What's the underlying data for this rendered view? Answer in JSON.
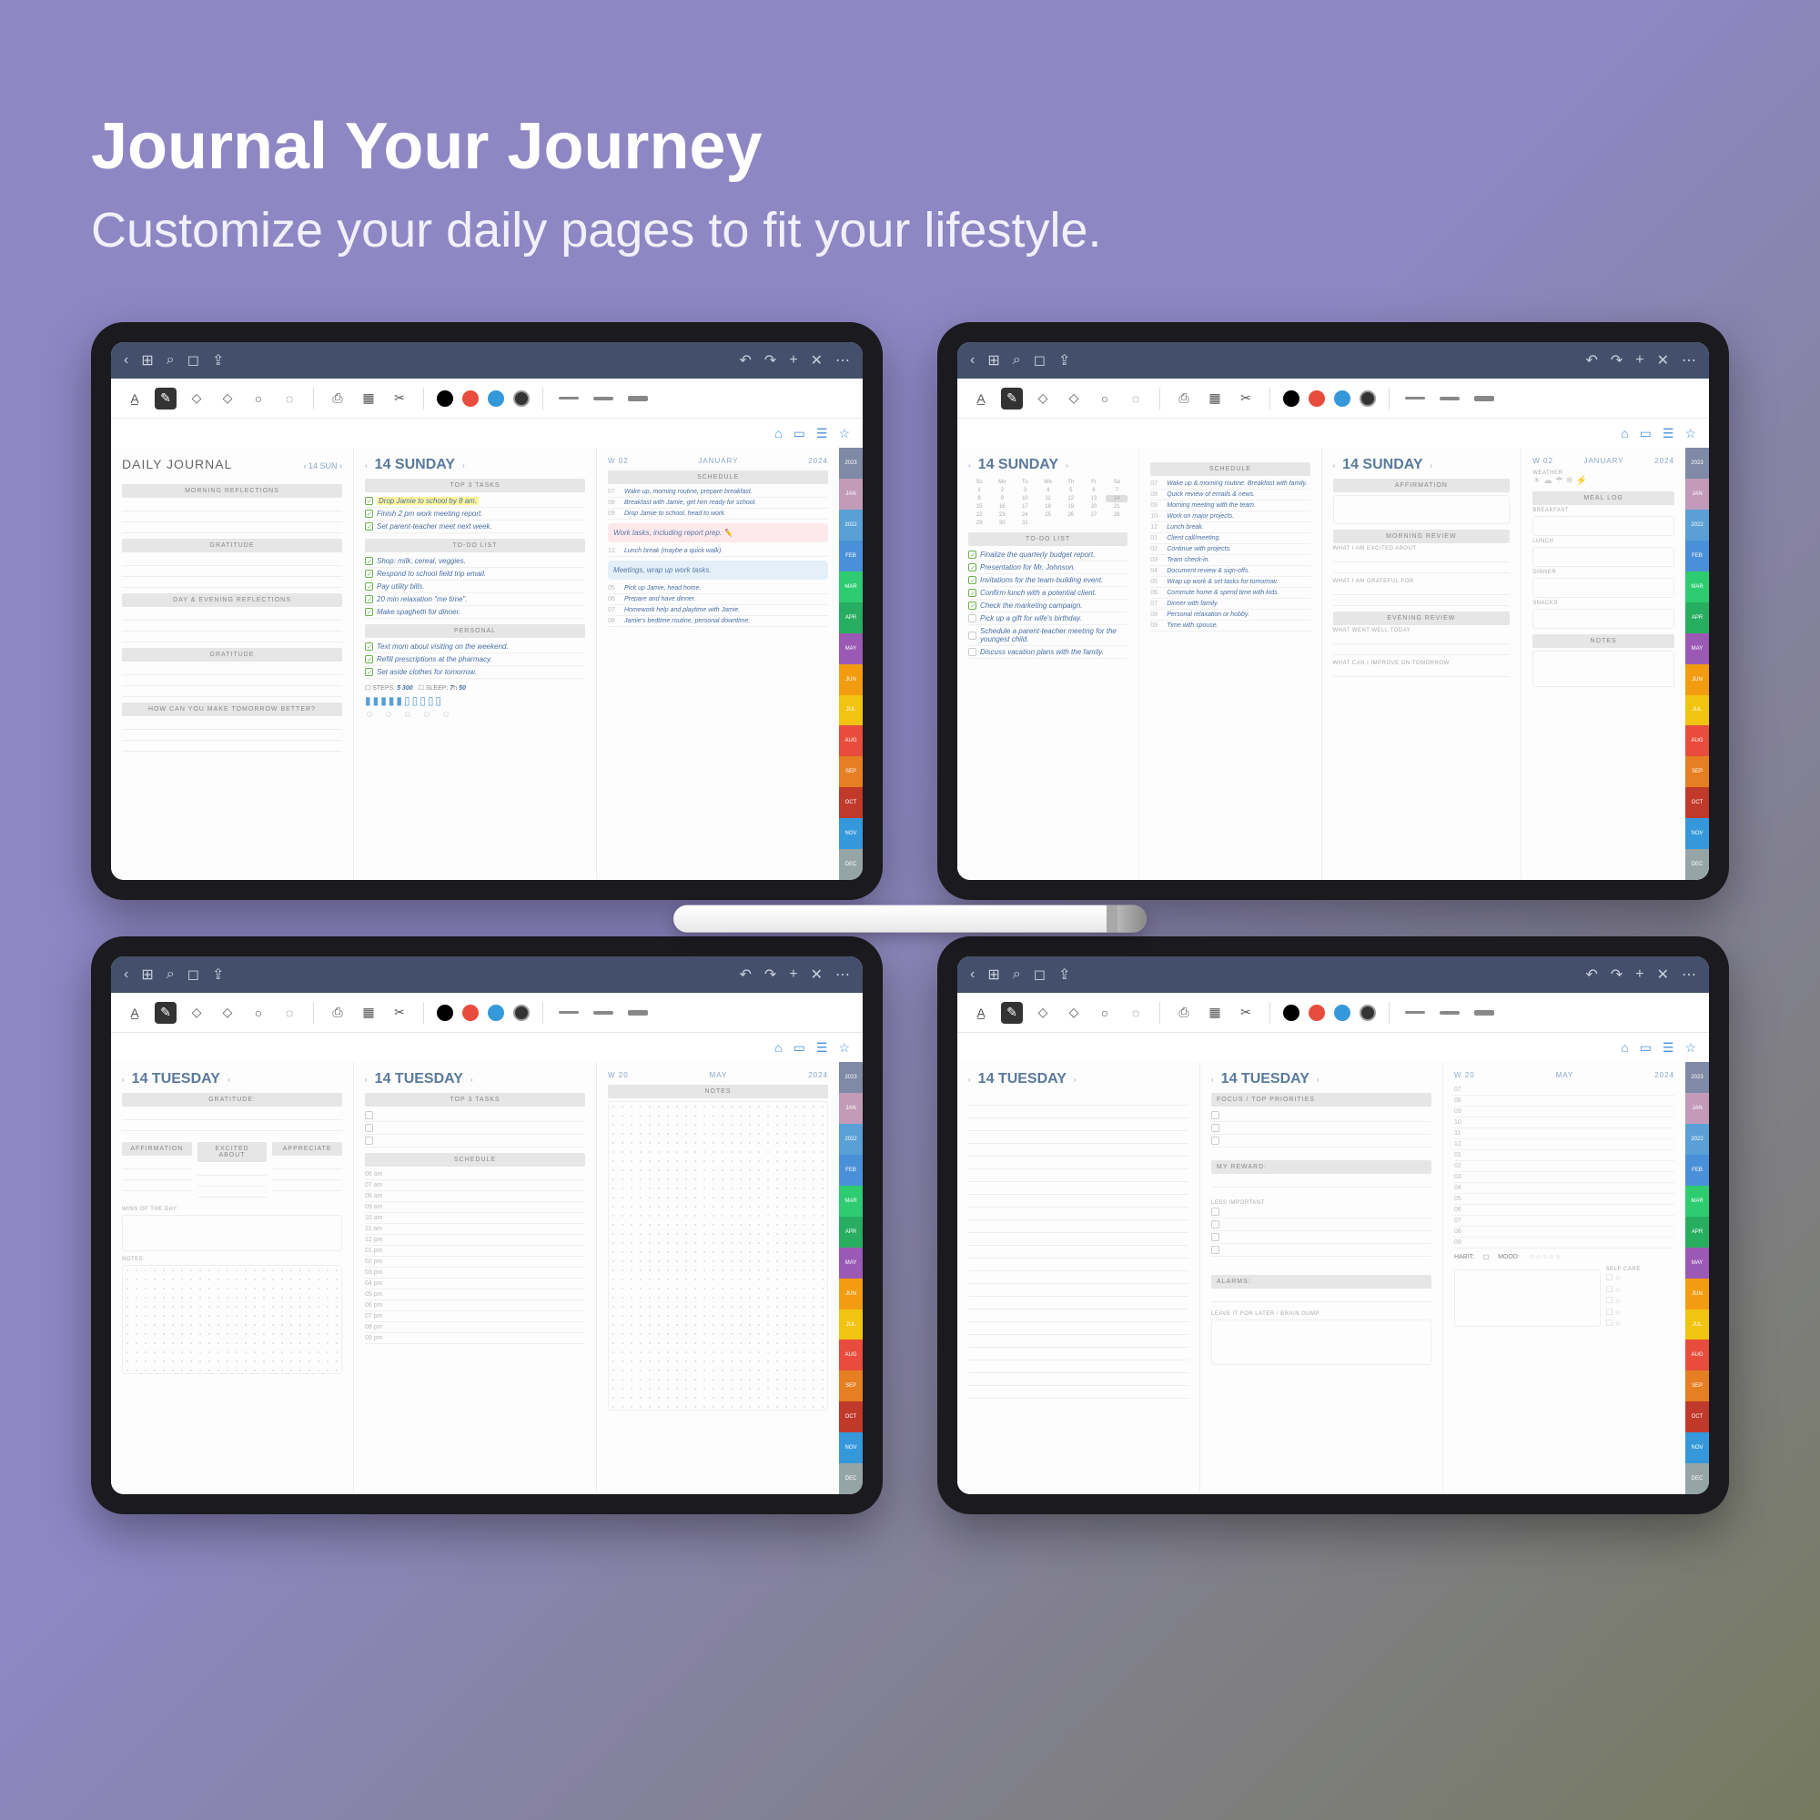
{
  "hero": {
    "title": "Journal Your Journey",
    "subtitle": "Customize your daily pages to fit your lifestyle."
  },
  "months": [
    "2023",
    "JAN",
    "2022",
    "FEB",
    "MAR",
    "APR",
    "MAY",
    "JUN",
    "JUL",
    "AUG",
    "SEP",
    "OCT",
    "NOV",
    "DEC"
  ],
  "tabColors": [
    "#7e8aa6",
    "#c39bb8",
    "#5aa0d6",
    "#4a90d9",
    "#2ecc71",
    "#27ae60",
    "#9b59b6",
    "#f39c12",
    "#f1c40f",
    "#e74c3c",
    "#e67e22",
    "#c0392b",
    "#3498db",
    "#95a5a6"
  ],
  "t1": {
    "left": {
      "title": "DAILY JOURNAL",
      "date": "14 SUN",
      "sections": [
        "MORNING REFLECTIONS",
        "GRATITUDE",
        "DAY & EVENING REFLECTIONS",
        "GRATITUDE",
        "HOW CAN YOU MAKE TOMORROW BETTER?"
      ]
    },
    "mid": {
      "date": "14 SUNDAY",
      "sections": {
        "top3": "TOP 3 TASKS",
        "top3_items": [
          "Drop Jamie to school by 8 am.",
          "Finish 2 pm work meeting report.",
          "Set parent-teacher meet next week."
        ],
        "todo": "TO-DO LIST",
        "todo_items": [
          "Shop: milk, cereal, veggies.",
          "Respond to school field trip email.",
          "Pay utility bills.",
          "20 min relaxation \"me time\".",
          "Make spaghetti for dinner."
        ],
        "personal": "PERSONAL",
        "personal_items": [
          "Text mom about visiting on the weekend.",
          "Refill prescriptions at the pharmacy.",
          "Set aside clothes for tomorrow."
        ],
        "steps_lbl": "STEPS:",
        "steps": "5 300",
        "sleep_lbl": "SLEEP:",
        "sleep_h": "7",
        "sleep_m": "50"
      }
    },
    "right": {
      "week": "W 02",
      "month": "JANUARY",
      "year": "2024",
      "sched": "SCHEDULE",
      "rows": [
        {
          "t": "07",
          "x": "Wake up, morning routine, prepare breakfast."
        },
        {
          "t": "08",
          "x": "Breakfast with Jamie, get him ready for school."
        },
        {
          "t": "09",
          "x": "Drop Jamie to school, head to work."
        },
        {
          "t": "12",
          "x": "Lunch break (maybe a quick walk)."
        },
        {
          "t": "05",
          "x": "Pick up Jamie, head home."
        },
        {
          "t": "06",
          "x": "Prepare and have dinner."
        },
        {
          "t": "07",
          "x": "Homework help and playtime with Jamie."
        },
        {
          "t": "08",
          "x": "Jamie's bedtime routine, personal downtime."
        }
      ],
      "note1": "Work tasks, including report prep.",
      "note2": "Meetings, wrap up work tasks."
    }
  },
  "t2": {
    "left": {
      "date": "14 SUNDAY",
      "todo": "TO-DO LIST",
      "items": [
        "Finalize the quarterly budget report.",
        "Presentation for Mr. Johnson.",
        "Invitations for the team-building event.",
        "Confirm lunch with a potential client.",
        "Check the marketing campaign.",
        "Pick up a gift for wife's birthday.",
        "Schedule a parent-teacher meeting for the youngest child.",
        "Discuss vacation plans with the family."
      ],
      "cal_days": [
        "Su",
        "Mo",
        "Tu",
        "We",
        "Th",
        "Fr",
        "Sa"
      ]
    },
    "mid": {
      "sched": "SCHEDULE",
      "rows": [
        {
          "t": "07",
          "x": "Wake up & morning routine. Breakfast with family."
        },
        {
          "t": "08",
          "x": "Quick review of emails & news."
        },
        {
          "t": "09",
          "x": "Morning meeting with the team."
        },
        {
          "t": "10",
          "x": "Work on major projects."
        },
        {
          "t": "12",
          "x": "Lunch break."
        },
        {
          "t": "01",
          "x": "Client call/meeting."
        },
        {
          "t": "02",
          "x": "Continue with projects."
        },
        {
          "t": "03",
          "x": "Team check-in."
        },
        {
          "t": "04",
          "x": "Document review & sign-offs."
        },
        {
          "t": "05",
          "x": "Wrap up work & set tasks for tomorrow."
        },
        {
          "t": "06",
          "x": "Commute home & spend time with kids."
        },
        {
          "t": "07",
          "x": "Dinner with family."
        },
        {
          "t": "08",
          "x": "Personal relaxation or hobby."
        },
        {
          "t": "09",
          "x": "Time with spouse."
        }
      ]
    },
    "r1": {
      "date": "14 SUNDAY",
      "aff": "AFFIRMATION",
      "mr": "MORNING REVIEW",
      "ex": "WHAT I AM EXCITED ABOUT",
      "gr": "WHAT I AM GRATEFUL FOR",
      "er": "EVENING REVIEW",
      "ww": "WHAT WENT WELL TODAY",
      "imp": "WHAT CAN I IMPROVE ON TOMORROW"
    },
    "r2": {
      "week": "W 02",
      "month": "JANUARY",
      "year": "2024",
      "wt": "WEATHER",
      "ml": "MEAL LOG",
      "bf": "BREAKFAST",
      "lu": "LUNCH",
      "dn": "DINNER",
      "sn": "SNACKS",
      "nt": "NOTES"
    }
  },
  "t3": {
    "left": {
      "date": "14 TUESDAY",
      "gr": "GRATITUDE:",
      "aff": "AFFIRMATION",
      "ex": "EXCITED ABOUT",
      "ap": "APPRECIATE",
      "wins": "WINS OF THE DAY:",
      "notes": "NOTES:"
    },
    "mid": {
      "date": "14 TUESDAY",
      "top3": "TOP 3 TASKS",
      "sched": "SCHEDULE",
      "hours": [
        "06 am",
        "07 am",
        "08 am",
        "09 am",
        "10 am",
        "11 am",
        "12 pm",
        "01 pm",
        "02 pm",
        "03 pm",
        "04 pm",
        "05 pm",
        "06 pm",
        "07 pm",
        "08 pm",
        "09 pm"
      ]
    },
    "right": {
      "week": "W 20",
      "month": "MAY",
      "year": "2024",
      "notes": "NOTES"
    }
  },
  "t4": {
    "left": {
      "date": "14 TUESDAY"
    },
    "mid": {
      "date": "14 TUESDAY",
      "focus": "FOCUS / TOP PRIORITIES",
      "reward": "MY REWARD:",
      "less": "LESS IMPORTANT",
      "alarms": "ALARMS:",
      "brain": "LEAVE IT FOR LATER / BRAIN DUMP:"
    },
    "right": {
      "week": "W 20",
      "month": "MAY",
      "year": "2024",
      "habit": "HABIT:",
      "mood": "MOOD:",
      "self": "SELF-CARE",
      "hours": [
        "07",
        "08",
        "09",
        "10",
        "11",
        "12",
        "01",
        "02",
        "03",
        "04",
        "05",
        "06",
        "07",
        "08",
        "09"
      ]
    }
  }
}
